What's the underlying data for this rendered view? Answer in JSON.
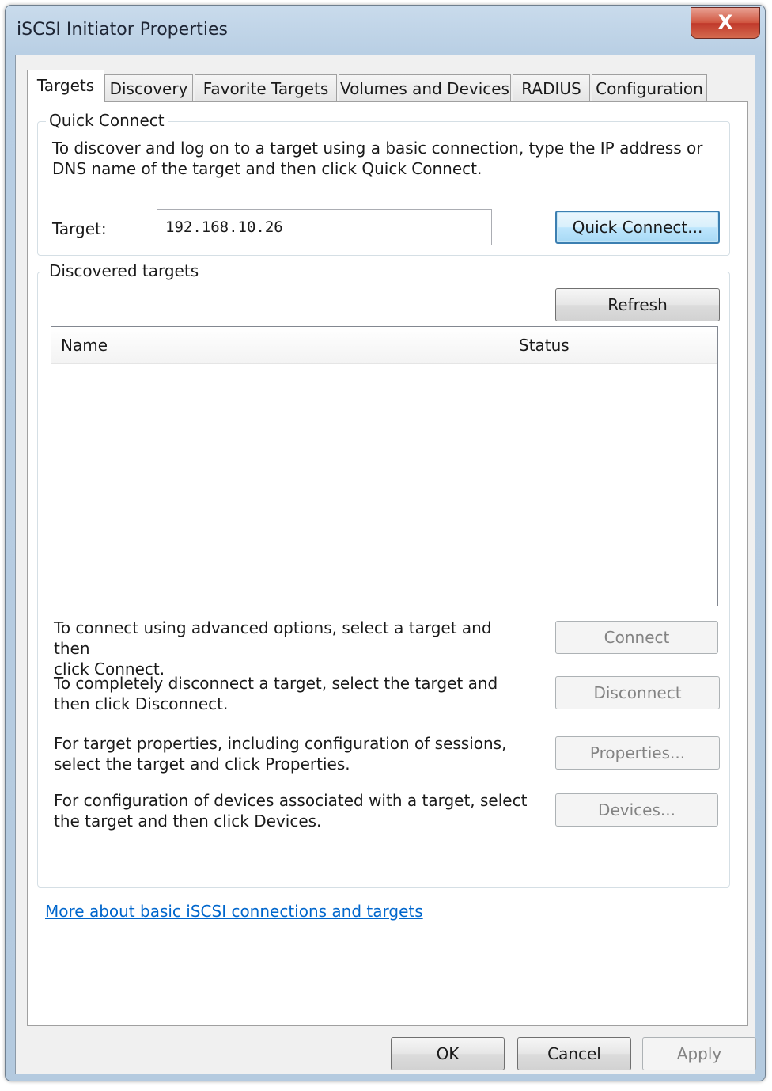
{
  "window": {
    "title": "iSCSI Initiator Properties",
    "close_label": "X"
  },
  "tabs": [
    {
      "label": "Targets",
      "active": true
    },
    {
      "label": "Discovery",
      "active": false
    },
    {
      "label": "Favorite Targets",
      "active": false
    },
    {
      "label": "Volumes and Devices",
      "active": false
    },
    {
      "label": "RADIUS",
      "active": false
    },
    {
      "label": "Configuration",
      "active": false
    }
  ],
  "quick_connect": {
    "legend": "Quick Connect",
    "description_line1": "To discover and log on to a target using a basic connection, type the IP address or",
    "description_line2": "DNS name of the target and then click Quick Connect.",
    "target_label": "Target:",
    "target_value": "192.168.10.26",
    "button_label": "Quick Connect..."
  },
  "discovered": {
    "legend": "Discovered targets",
    "refresh_label": "Refresh",
    "columns": [
      "Name",
      "Status"
    ],
    "rows": [],
    "actions": [
      {
        "line1": "To connect using advanced options, select a target and then",
        "line2": "click Connect.",
        "button": "Connect"
      },
      {
        "line1": "To completely disconnect a target, select the target and",
        "line2": "then click Disconnect.",
        "button": "Disconnect"
      },
      {
        "line1": "For target properties, including configuration of sessions,",
        "line2": "select the target and click Properties.",
        "button": "Properties..."
      },
      {
        "line1": "For configuration of devices associated with a target, select",
        "line2": "the target and then click Devices.",
        "button": "Devices..."
      }
    ]
  },
  "help_link": "More about basic iSCSI connections and targets",
  "footer": {
    "ok": "OK",
    "cancel": "Cancel",
    "apply": "Apply"
  }
}
